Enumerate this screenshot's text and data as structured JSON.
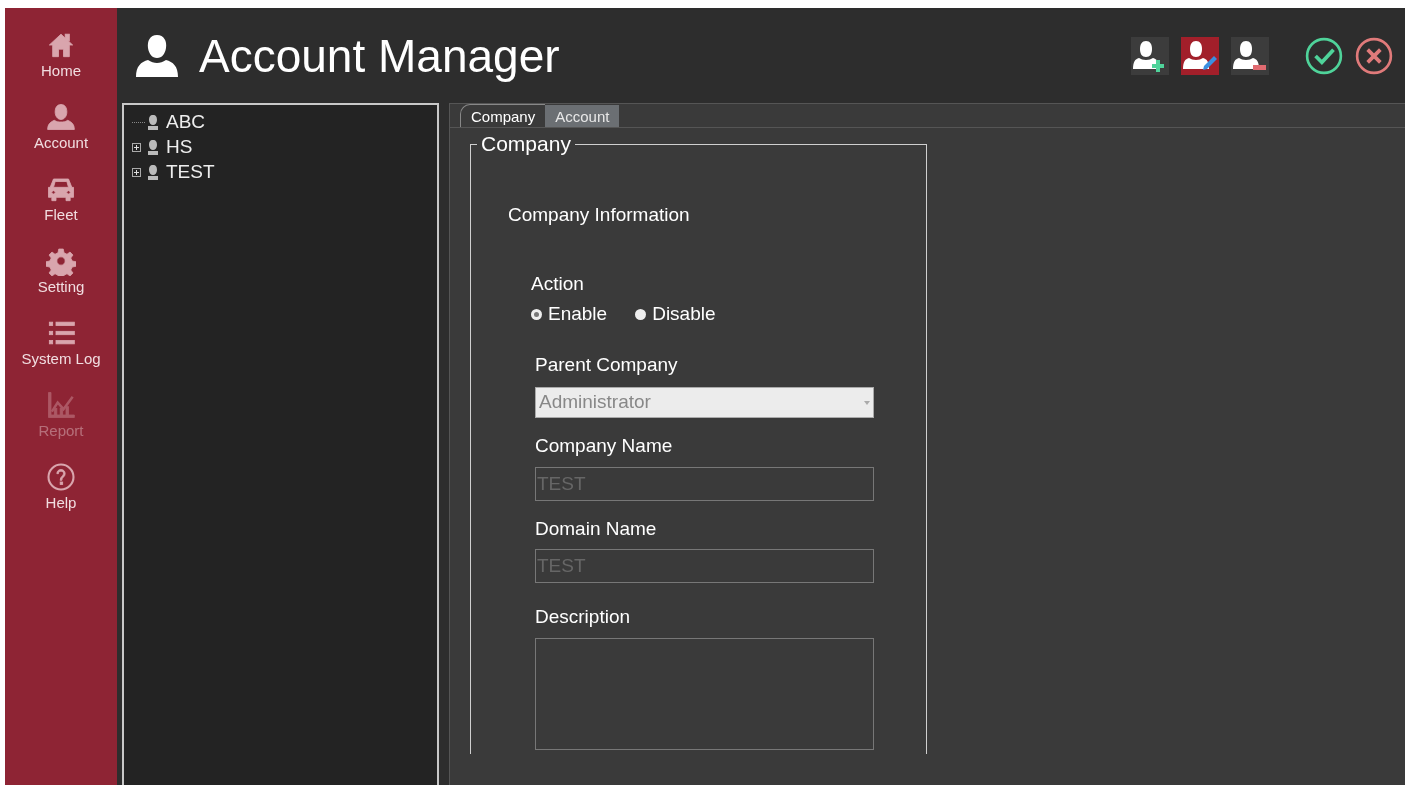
{
  "sidebar": {
    "items": [
      {
        "kind": "home",
        "label": "Home",
        "disabled": false
      },
      {
        "kind": "account",
        "label": "Account",
        "disabled": false
      },
      {
        "kind": "fleet",
        "label": "Fleet",
        "disabled": false
      },
      {
        "kind": "setting",
        "label": "Setting",
        "disabled": false
      },
      {
        "kind": "log",
        "label": "System Log",
        "disabled": false
      },
      {
        "kind": "report",
        "label": "Report",
        "disabled": true
      },
      {
        "kind": "help",
        "label": "Help",
        "disabled": false
      }
    ]
  },
  "header": {
    "title": "Account Manager",
    "toolbar": [
      {
        "kind": "add"
      },
      {
        "kind": "edit"
      },
      {
        "kind": "remove"
      },
      {
        "kind": "ok"
      },
      {
        "kind": "cancel"
      }
    ]
  },
  "tree": {
    "items": [
      {
        "label": "ABC",
        "kind": "leaf"
      },
      {
        "label": "HS",
        "kind": "group",
        "expanded": false
      },
      {
        "label": "TEST",
        "kind": "group",
        "expanded": false
      }
    ]
  },
  "tabs": [
    {
      "label": "Company",
      "selected": true
    },
    {
      "label": "Account",
      "selected": false
    }
  ],
  "form": {
    "group_title": "Company",
    "section_title": "Company Information",
    "action": {
      "label": "Action",
      "options": [
        {
          "label": "Enable",
          "selected": true
        },
        {
          "label": "Disable",
          "selected": false
        }
      ]
    },
    "parent_company": {
      "label": "Parent Company",
      "value": "Administrator"
    },
    "company_name": {
      "label": "Company Name",
      "value": "TEST"
    },
    "domain_name": {
      "label": "Domain Name",
      "value": "TEST"
    },
    "description": {
      "label": "Description"
    }
  }
}
